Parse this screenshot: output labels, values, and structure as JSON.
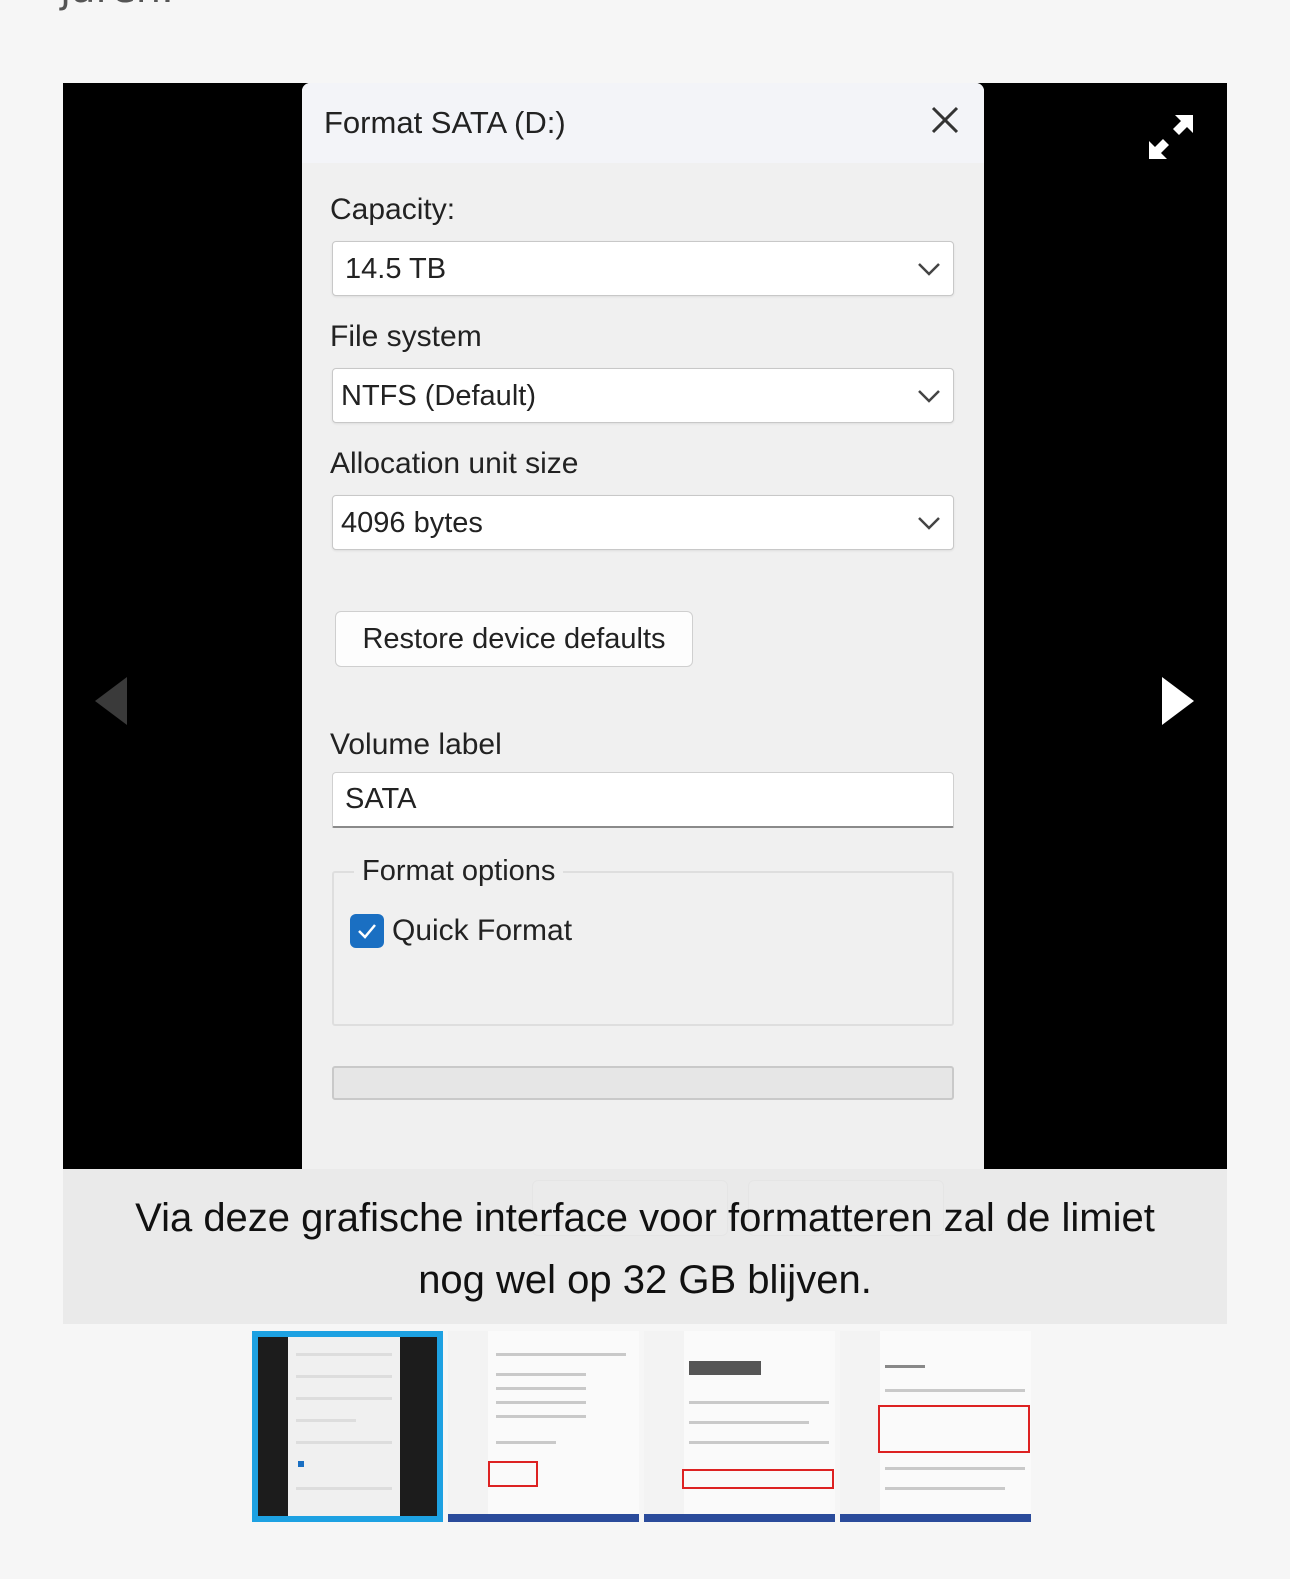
{
  "page": {
    "top_text": "jaren."
  },
  "dialog": {
    "title": "Format SATA (D:)",
    "capacity_label": "Capacity:",
    "capacity_value": "14.5 TB",
    "filesystem_label": "File system",
    "filesystem_value": "NTFS (Default)",
    "allocation_label": "Allocation unit size",
    "allocation_value": "4096 bytes",
    "restore_button": "Restore device defaults",
    "volume_label_label": "Volume label",
    "volume_label_value": "SATA",
    "format_options_label": "Format options",
    "quick_format_label": "Quick Format",
    "quick_format_checked": true
  },
  "caption": {
    "text": "Via deze grafische interface voor formatteren zal de limiet nog wel op 32 GB blijven."
  },
  "thumbnails": [
    {
      "name": "format-dialog",
      "active": true
    },
    {
      "name": "disks-volumes",
      "active": false
    },
    {
      "name": "display-hdr",
      "active": false
    },
    {
      "name": "power-battery",
      "active": false
    }
  ],
  "colors": {
    "accent": "#1da1e2",
    "checkbox": "#1a6fc2",
    "viewer_bg": "#000000"
  }
}
